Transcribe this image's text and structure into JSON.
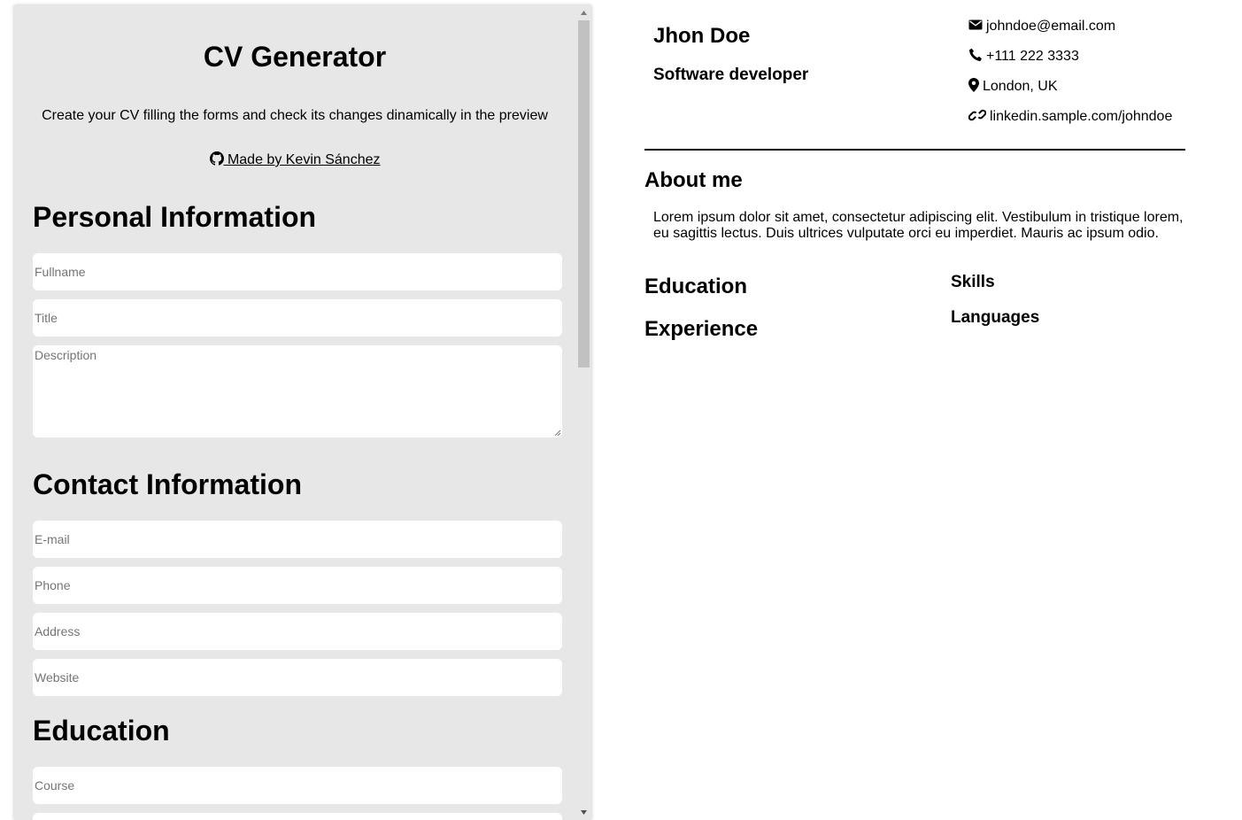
{
  "form": {
    "app_title": "CV Generator",
    "subtitle": "Create your CV filling the forms and check its changes dinamically in the preview",
    "author_link": " Made by Kevin Sánchez",
    "sections": {
      "personal": "Personal Information",
      "contact": "Contact Information",
      "education": "Education"
    },
    "placeholders": {
      "fullname": "Fullname",
      "title": "Title",
      "description": "Description",
      "email": "E-mail",
      "phone": "Phone",
      "address": "Address",
      "website": "Website",
      "course": "Course"
    }
  },
  "preview": {
    "name": "Jhon Doe",
    "title": "Software developer",
    "contact": {
      "email": "johndoe@email.com",
      "phone": "+111 222 3333",
      "address": "London, UK",
      "website": "linkedin.sample.com/johndoe"
    },
    "about_heading": "About me",
    "about_text": "Lorem ipsum dolor sit amet, consectetur adipiscing elit. Vestibulum in tristique lorem, eu sagittis lectus. Duis ultrices vulputate orci eu imperdiet. Mauris ac ipsum odio.",
    "education_heading": "Education",
    "experience_heading": "Experience",
    "skills_heading": "Skills",
    "languages_heading": "Languages"
  },
  "icons": {
    "github": "github-icon",
    "email": "envelope-icon",
    "phone": "phone-icon",
    "address": "map-marker-icon",
    "website": "link-icon"
  }
}
